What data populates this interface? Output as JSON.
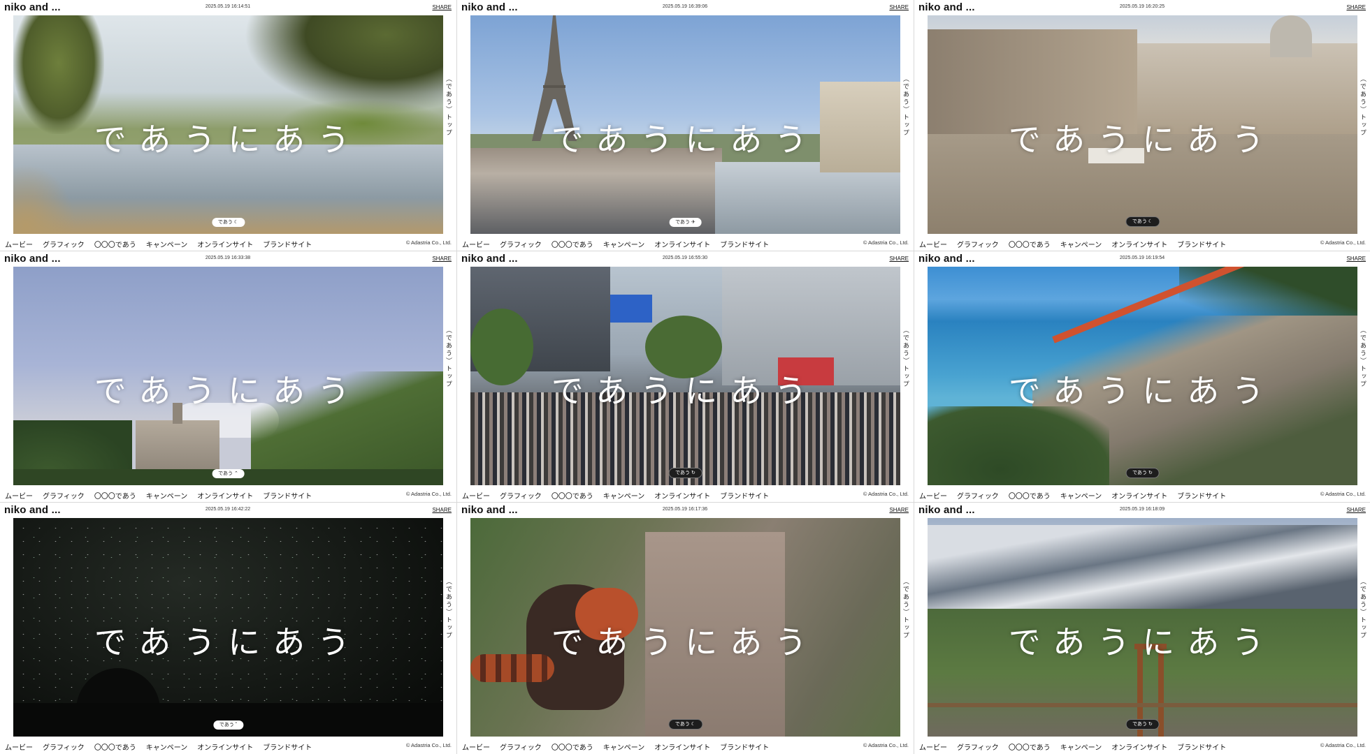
{
  "brand": "niko and ...",
  "share_label": "SHARE",
  "hero_text": "であうにあう",
  "side_label": "（であう）トップ",
  "nav_items": [
    "ムービー",
    "グラフィック",
    "〇〇〇であう",
    "キャンペーン",
    "オンラインサイト",
    "ブランドサイト"
  ],
  "copyright": "© Adastria Co., Ltd.",
  "panels": [
    {
      "timestamp": "2025.05.19  16:14:51",
      "badge": "であう ☾",
      "scene": "savanna-pond"
    },
    {
      "timestamp": "2025.05.19  16:39:06",
      "badge": "であう ✈",
      "scene": "paris-eiffel"
    },
    {
      "timestamp": "2025.05.19  16:20:25",
      "badge": "であう ☾",
      "scene": "venice-square"
    },
    {
      "timestamp": "2025.05.19  16:33:38",
      "badge": "であう ⌃",
      "scene": "castle-forest"
    },
    {
      "timestamp": "2025.05.19  16:55:30",
      "badge": "であう ↻",
      "scene": "shibuya-crossing"
    },
    {
      "timestamp": "2025.05.19  16:19:54",
      "badge": "であう ↻",
      "scene": "coast-railway"
    },
    {
      "timestamp": "2025.05.19  16:42:22",
      "badge": "であう ˚",
      "scene": "night-sky"
    },
    {
      "timestamp": "2025.05.19  16:17:36",
      "badge": "であう ☾",
      "scene": "red-panda"
    },
    {
      "timestamp": "2025.05.19  16:18:09",
      "badge": "であう ↻",
      "scene": "mountain-bridge"
    }
  ]
}
